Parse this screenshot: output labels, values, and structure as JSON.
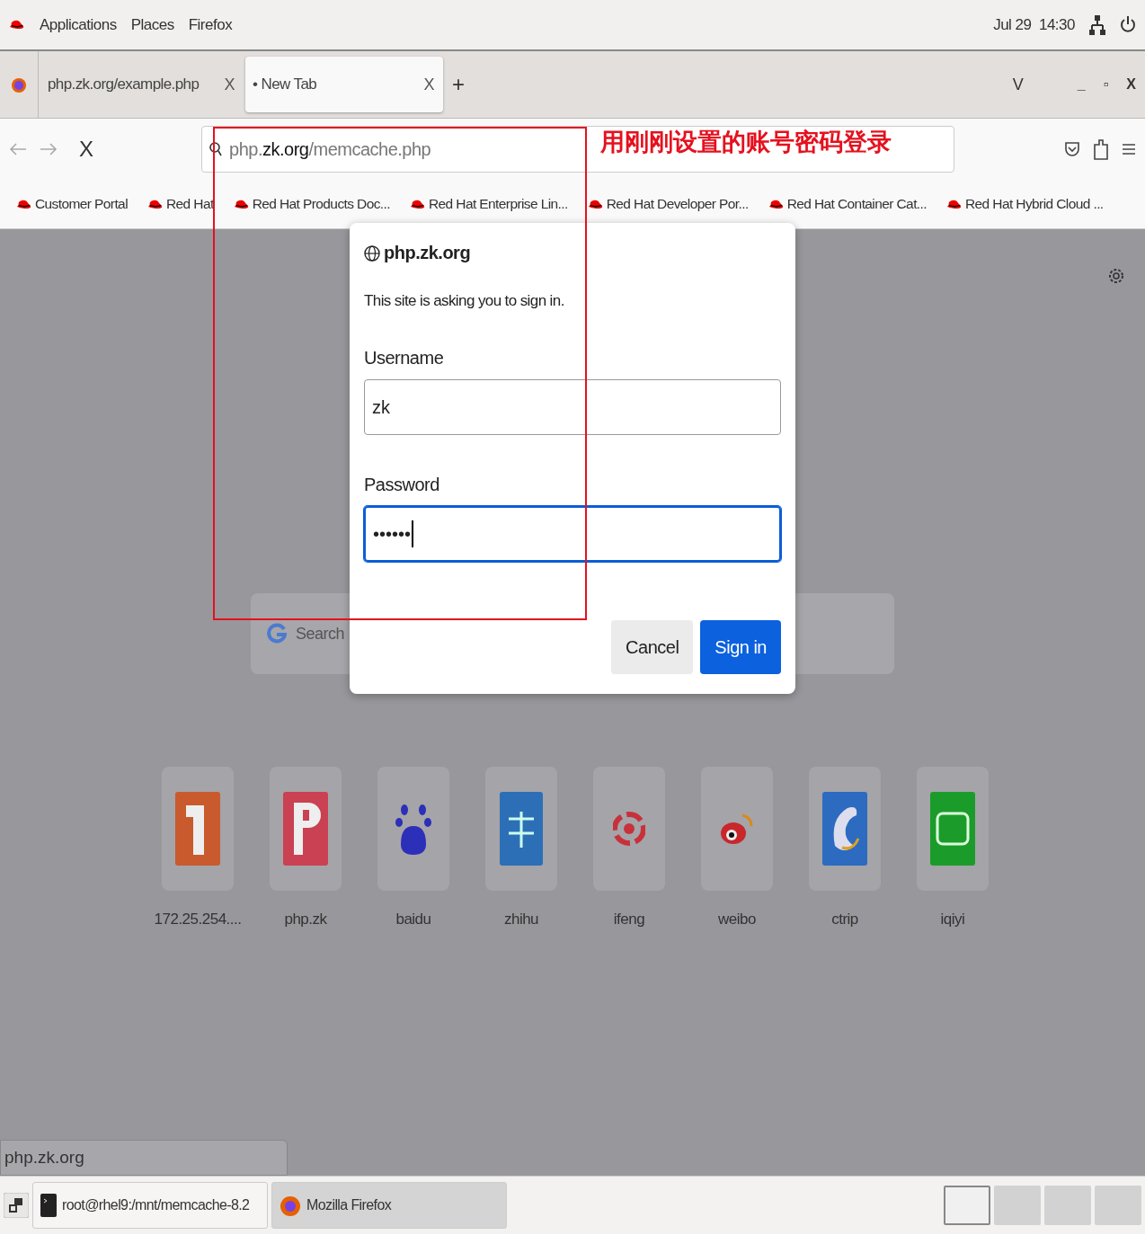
{
  "top_bar": {
    "menus": [
      "Applications",
      "Places",
      "Firefox"
    ],
    "clock": "Jul 29  14:30"
  },
  "tabs": [
    {
      "label": "php.zk.org/example.php",
      "close": "X",
      "selected": false
    },
    {
      "label": "• New Tab",
      "close": "X",
      "selected": true
    }
  ],
  "new_tab": "+",
  "tab_list": "V",
  "window_controls": [
    "_",
    "▫",
    "X"
  ],
  "nav": {
    "stop": "X",
    "url_host": "php.",
    "url_domain": "zk.org",
    "url_path": "/memcache.php"
  },
  "annotation": "用刚刚设置的账号密码登录",
  "bookmarks": [
    "Customer Portal",
    "Red Hat",
    "Red Hat Products Doc...",
    "Red Hat Enterprise Lin...",
    "Red Hat Developer Por...",
    "Red Hat Container Cat...",
    "Red Hat Hybrid Cloud ..."
  ],
  "search": {
    "placeholder": "Search"
  },
  "dialog": {
    "site": "php.zk.org",
    "message": "This site is asking you to sign in.",
    "username_label": "Username",
    "username": "zk",
    "password_label": "Password",
    "password": "••••••",
    "password_focused": true,
    "buttons": [
      {
        "label": "Cancel",
        "kind": "secondary"
      },
      {
        "label": "Sign in",
        "kind": "primary"
      }
    ]
  },
  "shortcuts": [
    {
      "label": "172.25.254....",
      "kind": "one"
    },
    {
      "label": "php.zk",
      "kind": "p"
    },
    {
      "label": "baidu",
      "kind": "paw"
    },
    {
      "label": "zhihu",
      "kind": "blue"
    },
    {
      "label": "ifeng",
      "kind": "swirl"
    },
    {
      "label": "weibo",
      "kind": "eye"
    },
    {
      "label": "ctrip",
      "kind": "dolphin"
    },
    {
      "label": "iqiyi",
      "kind": "green"
    }
  ],
  "status_url": "php.zk.org",
  "taskbar": {
    "windows": [
      {
        "label": "root@rhel9:/mnt/memcache-8.2",
        "kind": "terminal",
        "selected": false
      },
      {
        "label": "Mozilla Firefox",
        "kind": "firefox",
        "selected": true
      }
    ],
    "workspaces": [
      {
        "selected": true
      },
      {
        "selected": false
      },
      {
        "selected": false
      },
      {
        "selected": false
      }
    ]
  }
}
